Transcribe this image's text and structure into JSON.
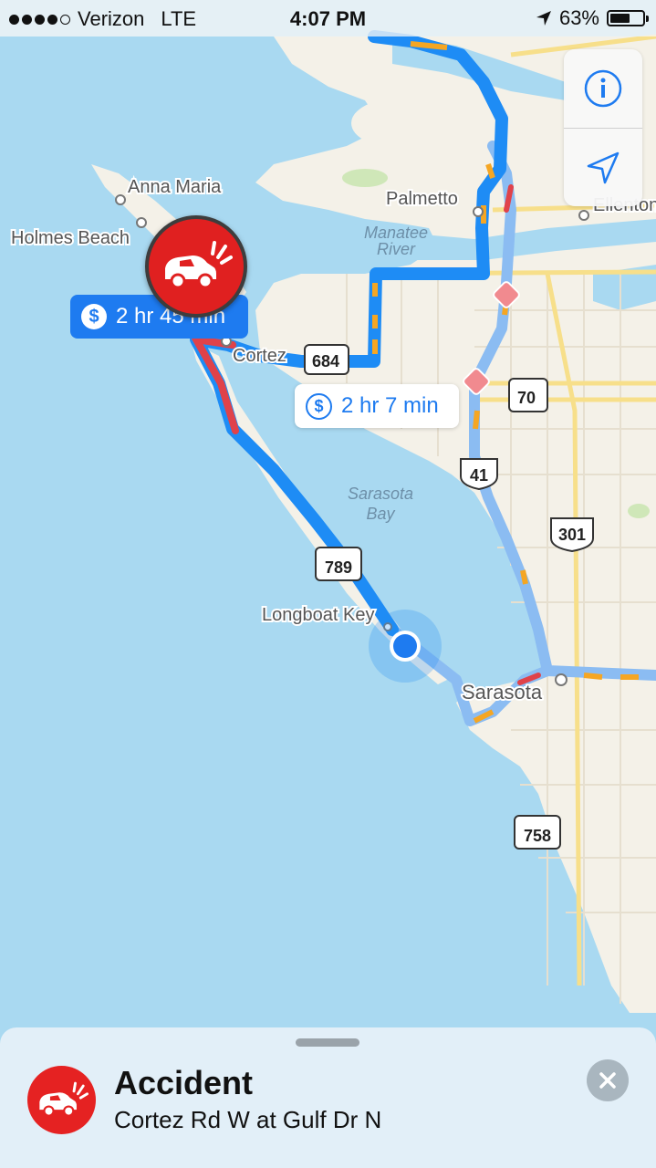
{
  "status_bar": {
    "carrier": "Verizon",
    "network": "LTE",
    "time": "4:07 PM",
    "battery": "63%",
    "battery_level": 0.63
  },
  "map": {
    "places": {
      "anna_maria": "Anna Maria",
      "holmes_beach": "Holmes Beach",
      "palmetto": "Palmetto",
      "ellenton": "Ellenton",
      "manatee_river_1": "Manatee",
      "manatee_river_2": "River",
      "cortez": "Cortez",
      "sarasota_bay_1": "Sarasota",
      "sarasota_bay_2": "Bay",
      "longboat_key": "Longboat Key",
      "sarasota": "Sarasota"
    },
    "shields": {
      "sr684": "684",
      "sr70": "70",
      "us41": "41",
      "us301": "301",
      "sr789": "789",
      "sr758": "758"
    },
    "colors": {
      "water": "#a9d9f1",
      "land": "#f4f1e8",
      "route_primary": "#1e8cf5",
      "route_alt": "#8bbcf2",
      "traffic_heavy": "#e0424a",
      "traffic_moderate": "#f5a623"
    }
  },
  "route_labels": {
    "primary": "2 hr 45 min",
    "alternate": "2 hr 7 min"
  },
  "controls": {
    "info_icon": "info-icon",
    "location_icon": "location-arrow-icon"
  },
  "incident": {
    "title": "Accident",
    "location": "Cortez Rd W at Gulf Dr N",
    "icon": "car-crash-icon"
  }
}
